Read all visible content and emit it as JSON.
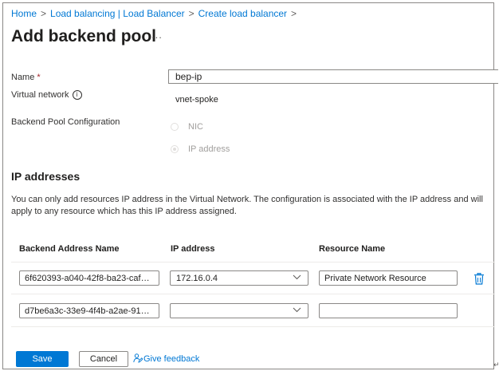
{
  "breadcrumb": {
    "items": [
      "Home",
      "Load balancing | Load Balancer",
      "Create load balancer"
    ],
    "separator": ">"
  },
  "header": {
    "title": "Add backend pool",
    "more_label": "..."
  },
  "form": {
    "name_label": "Name",
    "required_marker": "*",
    "name_value": "bep-ip",
    "vnet_label": "Virtual network",
    "info_icon_glyph": "i",
    "vnet_value": "vnet-spoke",
    "config_label": "Backend Pool Configuration",
    "options": [
      {
        "label": "NIC",
        "selected": false,
        "disabled": true
      },
      {
        "label": "IP address",
        "selected": true,
        "disabled": true
      }
    ]
  },
  "ip_section": {
    "title": "IP addresses",
    "description": "You can only add resources IP address in the Virtual Network. The configuration is associated with the IP address and will apply to any resource which has this IP address assigned.",
    "columns": [
      "Backend Address Name",
      "IP address",
      "Resource Name"
    ],
    "rows": [
      {
        "name": "6f620393-a040-42f8-ba23-caf4f4...",
        "ip": "172.16.0.4",
        "resource": "Private Network Resource",
        "delete_icon": "trash-icon"
      },
      {
        "name": "d7be6a3c-33e9-4f4b-a2ae-91e55...",
        "ip": "",
        "resource": "",
        "delete_icon": ""
      }
    ]
  },
  "footer": {
    "save_label": "Save",
    "cancel_label": "Cancel",
    "feedback_label": "Give feedback",
    "feedback_icon": "person-feedback-icon"
  },
  "trailing_mark": "↵",
  "colors": {
    "accent": "#0078d4",
    "border": "#8a8886",
    "text": "#323130",
    "disabled": "#a19f9d"
  }
}
